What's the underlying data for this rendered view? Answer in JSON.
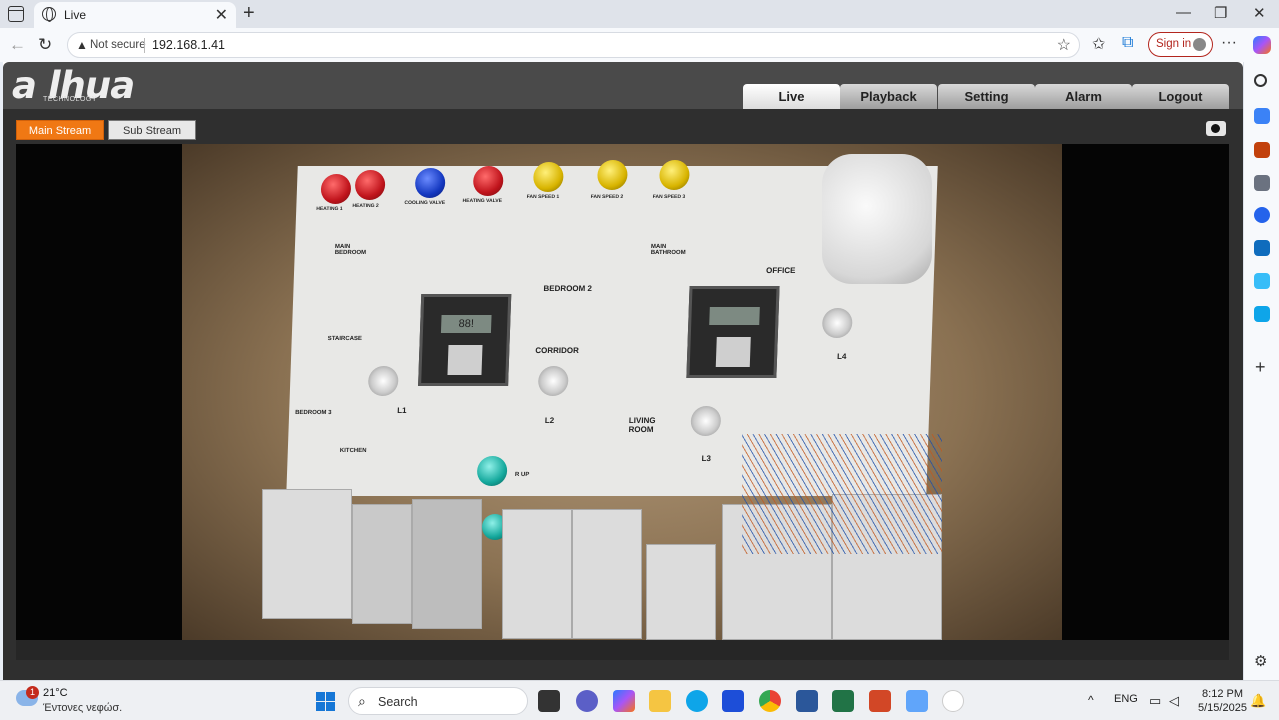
{
  "browser": {
    "tab_title": "Live",
    "tab_close": "✕",
    "new_tab": "+",
    "window_minimize": "—",
    "window_restore": "❐",
    "window_close": "✕",
    "security_label": "Not secure",
    "url": "192.168.1.41",
    "signin_label": "Sign in",
    "more_label": "···"
  },
  "dahua": {
    "logo_text": "a lhua",
    "logo_sub": "TECHNOLOGY",
    "nav": [
      "Live",
      "Playback",
      "Setting",
      "Alarm",
      "Logout"
    ],
    "active_nav": "Live",
    "main_stream_label": "Main Stream",
    "sub_stream_label": "Sub Stream"
  },
  "camera_scene": {
    "lamp_labels": [
      "HEATING 1",
      "HEATING 2",
      "COOLING VALVE",
      "HEATING VALVE",
      "FAN SPEED 1",
      "FAN SPEED 2",
      "FAN SPEED 3"
    ],
    "rooms": [
      "MAIN BEDROOM",
      "BEDROOM 2",
      "MAIN BATHROOM",
      "OFFICE",
      "STAIRCASE",
      "CORRIDOR",
      "BEDROOM 3",
      "KITCHEN",
      "LIVING ROOM"
    ],
    "light_labels": [
      "L1",
      "L2",
      "L3",
      "L4"
    ],
    "misc_label": "R UP",
    "lcd_text": "88!"
  },
  "taskbar": {
    "weather_badge": "1",
    "weather_temp": "21°C",
    "weather_desc": "Έντονες νεφώσ.",
    "search_label": "Search",
    "language": "ENG",
    "time": "8:12 PM",
    "date": "5/15/2025"
  },
  "colors": {
    "accent_orange": "#f07814",
    "header_gray": "#4a4a4a",
    "signin_red": "#b3261e"
  }
}
